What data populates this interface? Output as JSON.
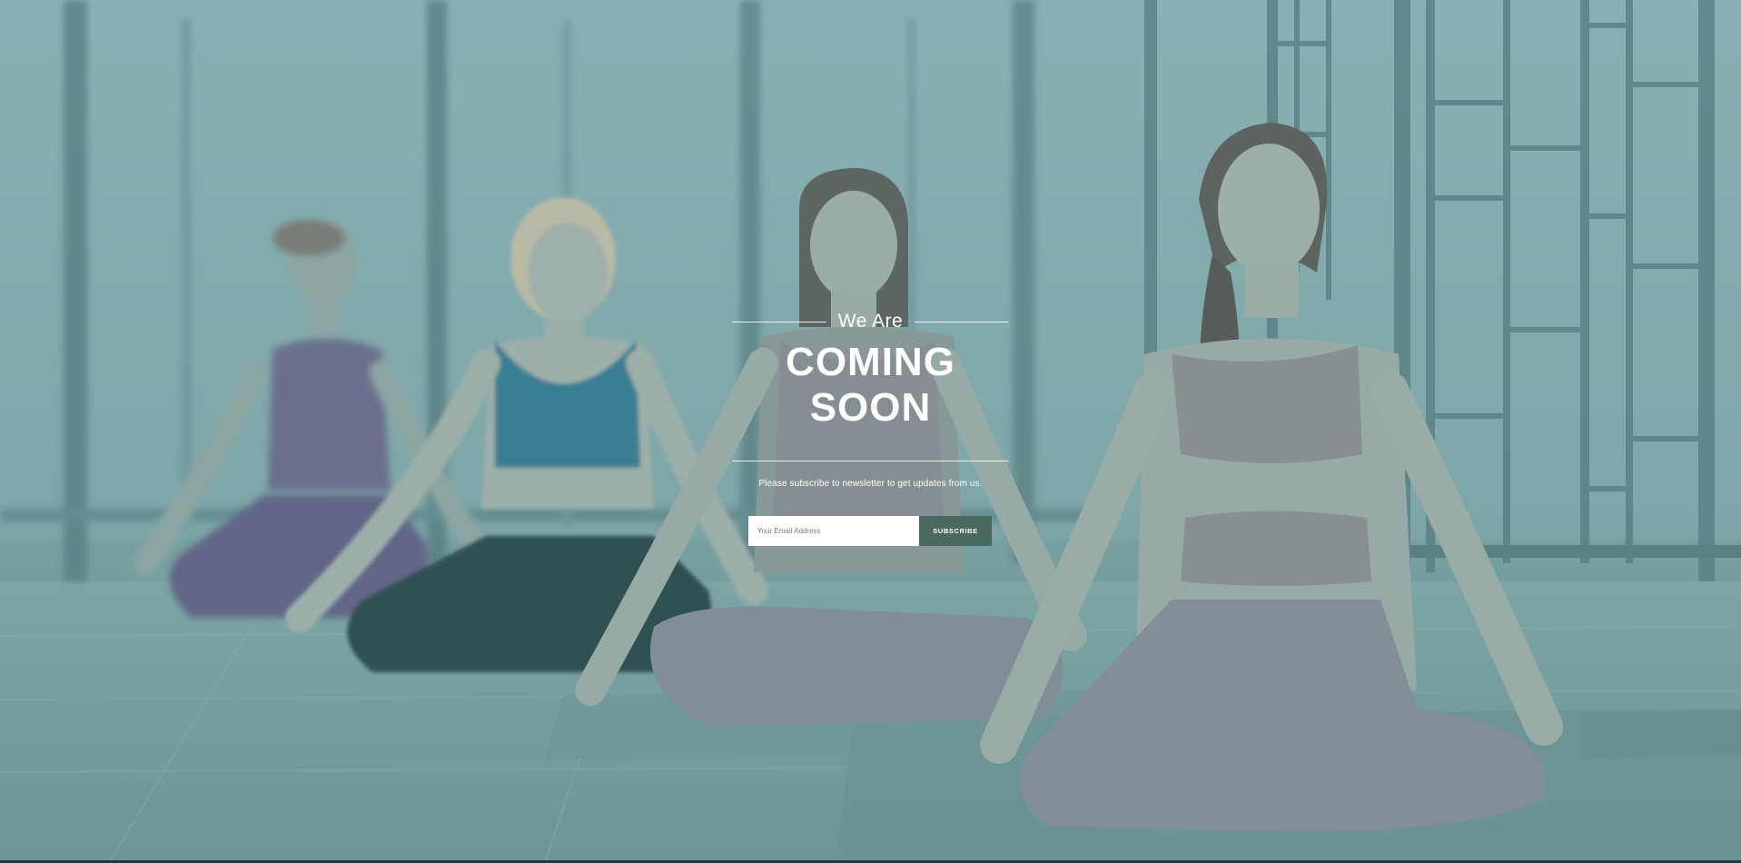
{
  "hero": {
    "pre_title": "We Are",
    "title_line1": "COMING",
    "title_line2": "SOON",
    "subtext": "Please subscribe to newsletter to get updates from us."
  },
  "newsletter": {
    "email_placeholder": "Your Email Address",
    "email_value": "",
    "subscribe_label": "SUBSCRIBE"
  },
  "colors": {
    "overlay_teal": "#6f9c9c",
    "button_bg": "#4a6a60",
    "text": "#ffffff"
  },
  "background": {
    "image_subject": "four women meditating in lotus pose in a yoga studio"
  }
}
